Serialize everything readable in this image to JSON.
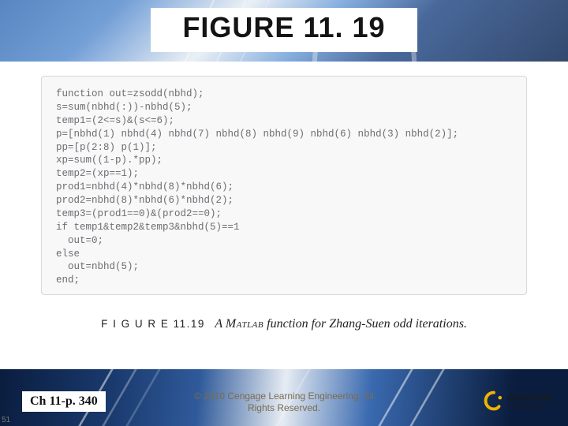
{
  "title": "FIGURE 11. 19",
  "code": "function out=zsodd(nbhd);\ns=sum(nbhd(:))-nbhd(5);\ntemp1=(2<=s)&(s<=6);\np=[nbhd(1) nbhd(4) nbhd(7) nbhd(8) nbhd(9) nbhd(6) nbhd(3) nbhd(2)];\npp=[p(2:8) p(1)];\nxp=sum((1-p).*pp);\ntemp2=(xp==1);\nprod1=nbhd(4)*nbhd(8)*nbhd(6);\nprod2=nbhd(8)*nbhd(6)*nbhd(2);\ntemp3=(prod1==0)&(prod2==0);\nif temp1&temp2&temp3&nbhd(5)==1\n  out=0;\nelse\n  out=nbhd(5);\nend;",
  "caption": {
    "label": "F I G U R E  11.19",
    "text_pre": "A ",
    "matlab": "Matlab",
    "text_post": " function for Zhang-Suen odd iterations."
  },
  "footer": {
    "left": "Ch 11-p. 340",
    "center_line1": "© 2010 Cengage Learning Engineering. All",
    "center_line2": "Rights Reserved.",
    "brand_top": "CENGAGE",
    "brand_bottom": "Learning"
  },
  "slide_number": "51"
}
